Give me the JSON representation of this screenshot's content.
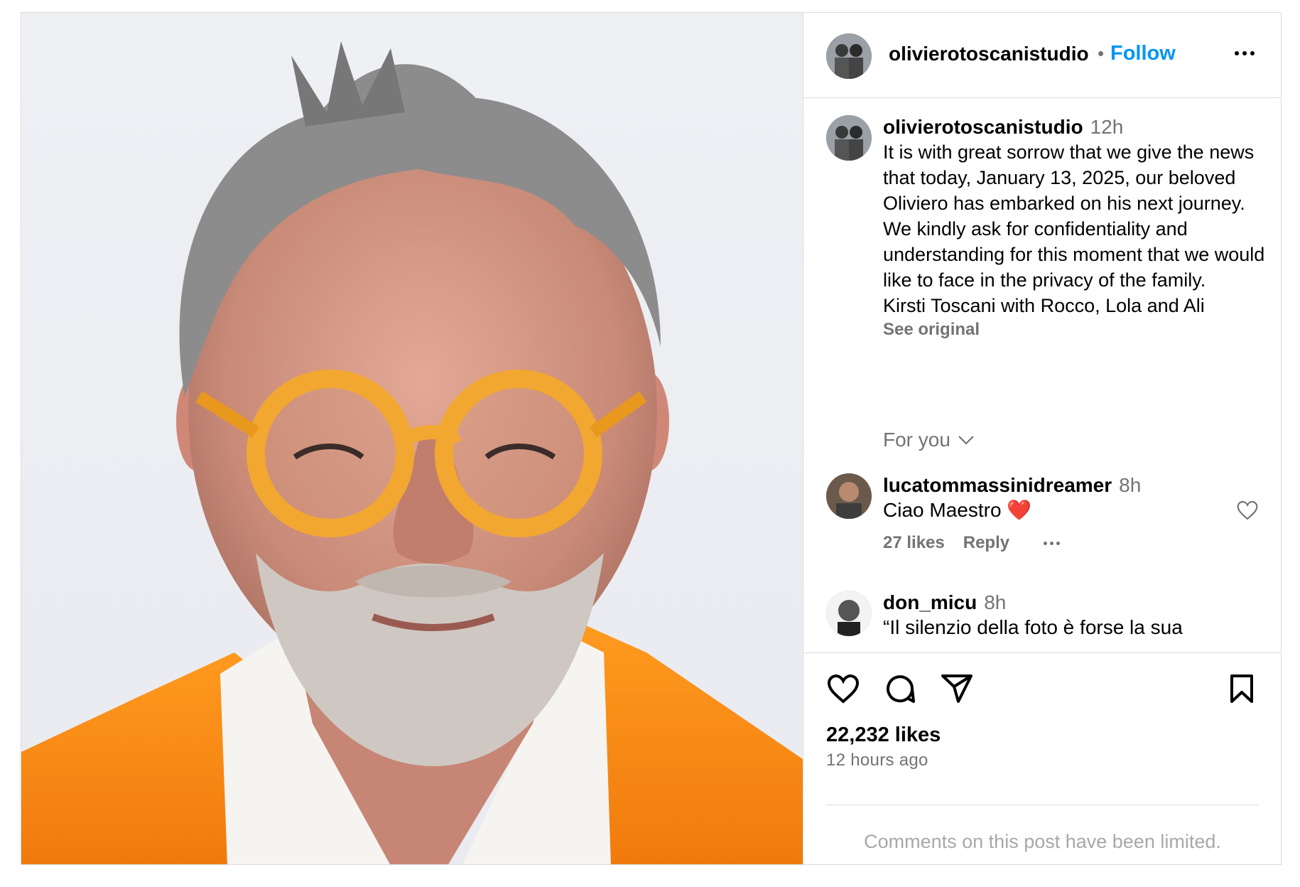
{
  "post": {
    "photo_alt": "portrait",
    "header": {
      "username": "olivierotoscanistudio",
      "separator": "•",
      "follow_label": "Follow",
      "more_icon": "more-horizontal-icon"
    },
    "caption": {
      "username": "olivierotoscanistudio",
      "time": "12h",
      "paragraphs": [
        "It is with great sorrow that we give the news that today, January 13, 2025, our beloved Oliviero has embarked on his next journey.",
        "We kindly ask for confidentiality and understanding for this moment that we would like to face in the privacy of the family.",
        "Kirsti Toscani with Rocco, Lola and Ali"
      ],
      "see_original": "See original"
    },
    "filter": {
      "label": "For you",
      "icon": "chevron-down-icon"
    },
    "comments": [
      {
        "username": "lucatommassinidreamer",
        "time": "8h",
        "text": "Ciao Maestro ❤️",
        "likes": "27 likes",
        "reply": "Reply"
      },
      {
        "username": "don_micu",
        "time": "8h",
        "text": "“Il silenzio della foto è forse la sua"
      }
    ],
    "actions": {
      "like_icon": "heart-icon",
      "comment_icon": "comment-icon",
      "share_icon": "send-icon",
      "save_icon": "bookmark-icon"
    },
    "likes": "22,232 likes",
    "posted_ago": "12 hours ago",
    "comments_limited": "Comments on this post have been limited."
  }
}
